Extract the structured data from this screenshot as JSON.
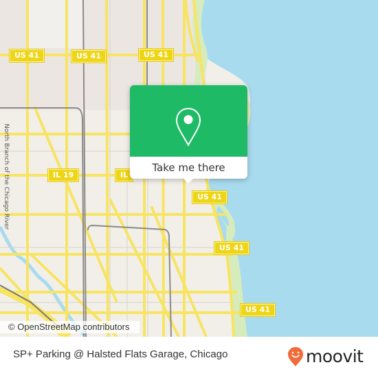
{
  "map": {
    "city": "Chicago",
    "colors": {
      "land": "#f2efe9",
      "water": "#a8dbee",
      "road": "#f7e463",
      "park": "#d6ecbc",
      "rail": "#8a8a8a"
    },
    "shields": [
      {
        "label": "US 41"
      },
      {
        "label": "US 41"
      },
      {
        "label": "US 41"
      },
      {
        "label": "IL 19"
      },
      {
        "label": "IL"
      },
      {
        "label": "US 41"
      },
      {
        "label": "US 41"
      },
      {
        "label": "US 41"
      }
    ],
    "river_label": "North Branch of the Chicago River",
    "attribution": "© OpenStreetMap contributors"
  },
  "popup": {
    "icon": "map-pin-icon",
    "button_label": "Take me there",
    "color": "#1fba66"
  },
  "footer": {
    "place_name": "SP+ Parking @ Halsted Flats Garage, Chicago",
    "logo_text": "moovit",
    "logo_color": "#f26b3a"
  }
}
